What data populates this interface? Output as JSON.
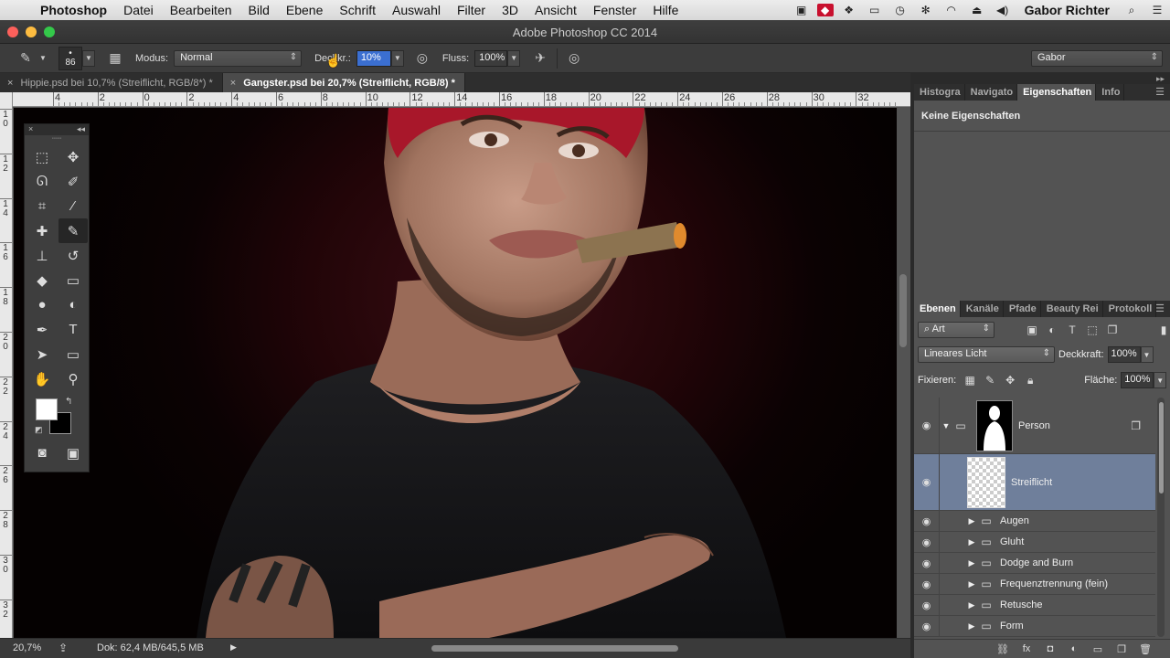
{
  "menubar": {
    "app": "Photoshop",
    "items": [
      "Datei",
      "Bearbeiten",
      "Bild",
      "Ebene",
      "Schrift",
      "Auswahl",
      "Filter",
      "3D",
      "Ansicht",
      "Fenster",
      "Hilfe"
    ],
    "user": "Gabor Richter"
  },
  "window": {
    "title": "Adobe Photoshop CC 2014"
  },
  "options": {
    "brush_size": "86",
    "mode_label": "Modus:",
    "mode_value": "Normal",
    "opacity_label": "Deckkr.:",
    "opacity_value": "10%",
    "flow_label": "Fluss:",
    "flow_value": "100%",
    "workspace": "Gabor"
  },
  "tabs": [
    {
      "label": "Hippie.psd bei 10,7% (Streiflicht, RGB/8*) *",
      "active": false
    },
    {
      "label": "Gangster.psd bei 20,7% (Streiflicht, RGB/8) *",
      "active": true
    }
  ],
  "ruler": {
    "top_labels": [
      "4",
      "2",
      "0",
      "2",
      "4",
      "6",
      "8",
      "10",
      "12",
      "14",
      "16",
      "18",
      "20",
      "22",
      "24",
      "26",
      "28",
      "30",
      "32"
    ],
    "left_labels": [
      "1 0",
      "1 2",
      "1 4",
      "1 6",
      "1 8",
      "2 0",
      "2 2",
      "2 4",
      "2 6",
      "2 8",
      "3 0",
      "3 2"
    ]
  },
  "status": {
    "zoom": "20,7%",
    "doc_info": "Dok: 62,4 MB/645,5 MB"
  },
  "top_panel": {
    "tabs": [
      "Histogra",
      "Navigato",
      "Eigenschaften",
      "Info"
    ],
    "active": "Eigenschaften",
    "properties_header": "Keine Eigenschaften"
  },
  "layers_panel": {
    "tabs": [
      "Ebenen",
      "Kanäle",
      "Pfade",
      "Beauty Rei",
      "Protokoll"
    ],
    "active": "Ebenen",
    "filter_kind": "Art",
    "blend_mode": "Lineares Licht",
    "opacity_label": "Deckkraft:",
    "opacity_value": "100%",
    "lock_label": "Fixieren:",
    "fill_label": "Fläche:",
    "fill_value": "100%",
    "layers": [
      {
        "name": "Person",
        "type": "group-mask",
        "expanded": true
      },
      {
        "name": "Streiflicht",
        "type": "pixel",
        "selected": true
      },
      {
        "name": "Augen",
        "type": "group"
      },
      {
        "name": "Gluht",
        "type": "group"
      },
      {
        "name": "Dodge and Burn",
        "type": "group"
      },
      {
        "name": "Frequenztrennung (fein)",
        "type": "group"
      },
      {
        "name": "Retusche",
        "type": "group"
      },
      {
        "name": "Form",
        "type": "group"
      }
    ]
  },
  "colors": {
    "foreground": "#ffffff",
    "background": "#000000",
    "selected_layer": "#6f7f9b"
  }
}
